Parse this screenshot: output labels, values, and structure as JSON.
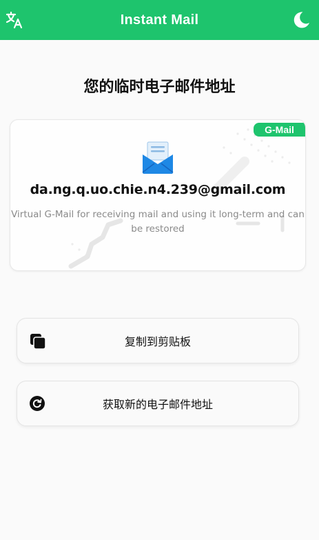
{
  "header": {
    "title": "Instant Mail",
    "translate_icon": "translate-icon",
    "theme_icon": "moon-icon",
    "background": "#1ec46d"
  },
  "main": {
    "title": "您的临时电子邮件地址"
  },
  "email_card": {
    "badge": "G-Mail",
    "icon": "mail-envelope-icon",
    "email": "da.ng.q.uo.chie.n4.239@gmail.com",
    "description": "Virtual G-Mail for receiving mail and using it long-term and can be restored"
  },
  "actions": {
    "copy_label": "复制到剪贴板",
    "copy_icon": "copy-icon",
    "new_label": "获取新的电子邮件地址",
    "new_icon": "refresh-icon"
  },
  "colors": {
    "accent": "#1ec46d",
    "mail_icon": "#1e88e5"
  }
}
